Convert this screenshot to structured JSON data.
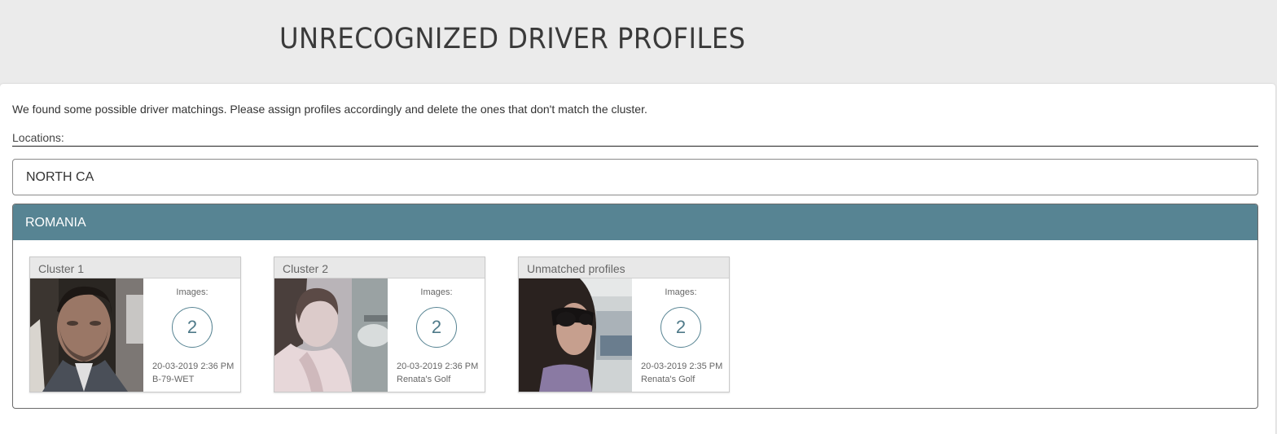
{
  "header": {
    "title": "UNRECOGNIZED DRIVER PROFILES"
  },
  "intro": "We found some possible driver matchings. Please assign profiles accordingly and delete the ones that don't match the cluster.",
  "locations": {
    "label": "Locations:",
    "items": [
      {
        "name": "NORTH CA"
      }
    ]
  },
  "group": {
    "name": "ROMANIA",
    "accent_color": "#578493",
    "cards": [
      {
        "title": "Cluster 1",
        "images_label": "Images:",
        "count": "2",
        "date": "20-03-2019 2:36 PM",
        "vehicle": "B-79-WET",
        "photo": "driver-face-photo"
      },
      {
        "title": "Cluster 2",
        "images_label": "Images:",
        "count": "2",
        "date": "20-03-2019 2:36 PM",
        "vehicle": "Renata's Golf",
        "photo": "driver-face-photo"
      },
      {
        "title": "Unmatched profiles",
        "images_label": "Images:",
        "count": "2",
        "date": "20-03-2019 2:35 PM",
        "vehicle": "Renata's Golf",
        "photo": "driver-face-photo"
      }
    ]
  }
}
